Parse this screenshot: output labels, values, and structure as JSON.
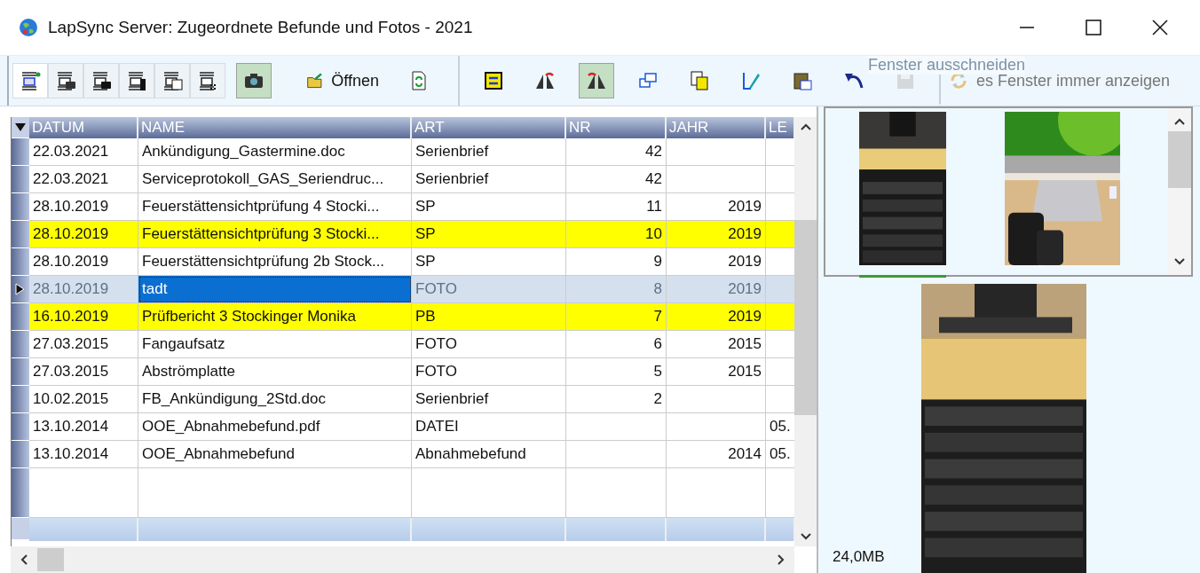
{
  "window": {
    "title": "LapSync Server: Zugeordnete Befunde und Fotos - 2021"
  },
  "toolbar": {
    "left": [
      {
        "kind": "list-add",
        "selected": true
      },
      {
        "kind": "list-camera",
        "selected": false
      },
      {
        "kind": "list-camera-dark",
        "selected": false
      },
      {
        "kind": "list-flash",
        "selected": false
      },
      {
        "kind": "list-calendar",
        "selected": false
      },
      {
        "kind": "list-grid",
        "selected": false
      },
      {
        "kind": "camera",
        "selected": true
      },
      {
        "kind": "folder-open",
        "selected": false,
        "label": "Öffnen"
      },
      {
        "kind": "doc-refresh",
        "selected": false
      }
    ],
    "right": [
      {
        "kind": "crop",
        "selected": false
      },
      {
        "kind": "mirror-left",
        "selected": false
      },
      {
        "kind": "mirror-right",
        "selected": true
      },
      {
        "kind": "window",
        "selected": false
      },
      {
        "kind": "copy",
        "selected": false
      },
      {
        "kind": "pen",
        "selected": false
      },
      {
        "kind": "paste",
        "selected": false
      },
      {
        "kind": "undo",
        "selected": false
      },
      {
        "kind": "save",
        "selected": false,
        "disabled": true
      },
      {
        "kind": "sync",
        "selected": false,
        "disabled": true,
        "label": "es Fenster immer anzeigen"
      }
    ],
    "tooltip": "Fenster ausschneiden"
  },
  "table": {
    "columns": [
      "DATUM",
      "NAME",
      "ART",
      "NR",
      "JAHR",
      "LE"
    ],
    "rows": [
      {
        "cells": [
          "22.03.2021",
          "Ankündigung_Gastermine.doc",
          "Serienbrief",
          "42",
          "",
          ""
        ],
        "highlighted": false,
        "selected": false
      },
      {
        "cells": [
          "22.03.2021",
          "Serviceprotokoll_GAS_Seriendruc...",
          "Serienbrief",
          "42",
          "",
          ""
        ],
        "highlighted": false,
        "selected": false
      },
      {
        "cells": [
          "28.10.2019",
          "Feuerstättensichtprüfung 4  Stocki...",
          "SP",
          "11",
          "2019",
          ""
        ],
        "highlighted": false,
        "selected": false
      },
      {
        "cells": [
          "28.10.2019",
          "Feuerstättensichtprüfung 3  Stocki...",
          "SP",
          "10",
          "2019",
          ""
        ],
        "highlighted": true,
        "selected": false
      },
      {
        "cells": [
          "28.10.2019",
          "Feuerstättensichtprüfung 2b  Stock...",
          "SP",
          "9",
          "2019",
          ""
        ],
        "highlighted": false,
        "selected": false
      },
      {
        "cells": [
          "28.10.2019",
          "tadt",
          "FOTO",
          "8",
          "2019",
          ""
        ],
        "highlighted": false,
        "selected": true
      },
      {
        "cells": [
          "16.10.2019",
          "Prüfbericht 3  Stockinger Monika",
          "PB",
          "7",
          "2019",
          ""
        ],
        "highlighted": true,
        "selected": false
      },
      {
        "cells": [
          "27.03.2015",
          "Fangaufsatz",
          "FOTO",
          "6",
          "2015",
          ""
        ],
        "highlighted": false,
        "selected": false
      },
      {
        "cells": [
          "27.03.2015",
          "Abströmplatte",
          "FOTO",
          "5",
          "2015",
          ""
        ],
        "highlighted": false,
        "selected": false
      },
      {
        "cells": [
          "10.02.2015",
          "FB_Ankündigung_2Std.doc",
          "Serienbrief",
          "2",
          "",
          ""
        ],
        "highlighted": false,
        "selected": false
      },
      {
        "cells": [
          "13.10.2014",
          "OOE_Abnahmebefund.pdf",
          "DATEI",
          "",
          "",
          "05."
        ],
        "highlighted": false,
        "selected": false
      },
      {
        "cells": [
          "13.10.2014",
          "OOE_Abnahmebefund",
          "Abnahmebefund",
          "",
          "2014",
          "05."
        ],
        "highlighted": false,
        "selected": false
      }
    ]
  },
  "preview": {
    "thumbnails": [
      {
        "kind": "picture",
        "selected": true
      },
      {
        "kind": "picture",
        "selected": false
      }
    ],
    "size": "24,0MB"
  }
}
